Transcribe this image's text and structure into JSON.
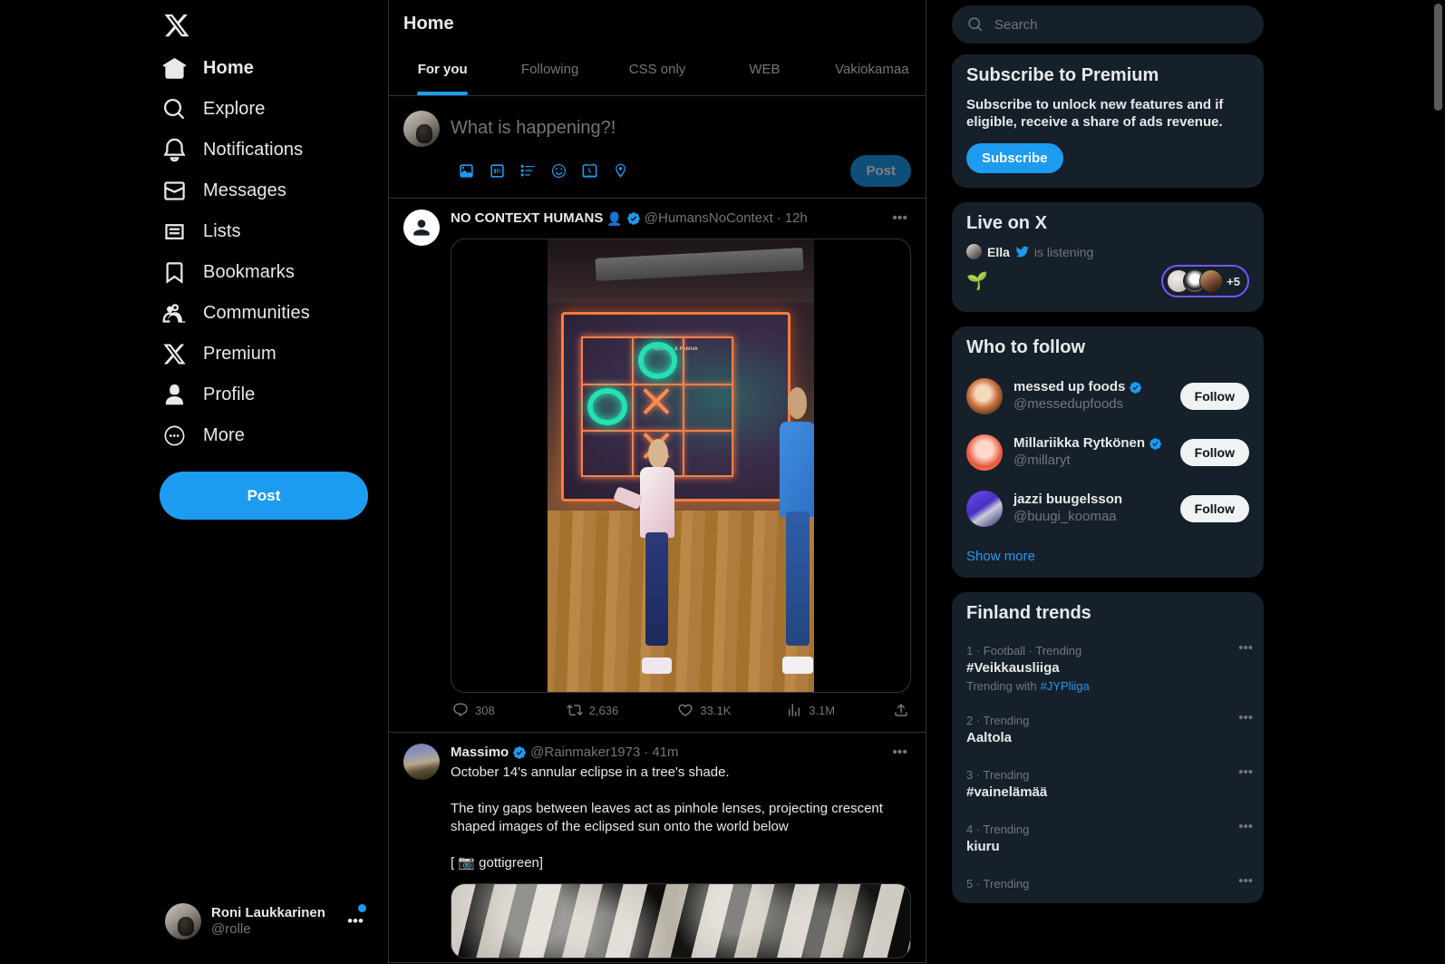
{
  "sidebar": {
    "logo": "x-logo",
    "items": [
      {
        "label": "Home",
        "icon": "home-icon"
      },
      {
        "label": "Explore",
        "icon": "search-icon"
      },
      {
        "label": "Notifications",
        "icon": "bell-icon"
      },
      {
        "label": "Messages",
        "icon": "envelope-icon"
      },
      {
        "label": "Lists",
        "icon": "list-icon"
      },
      {
        "label": "Bookmarks",
        "icon": "bookmark-icon"
      },
      {
        "label": "Communities",
        "icon": "people-icon"
      },
      {
        "label": "Premium",
        "icon": "x-icon"
      },
      {
        "label": "Profile",
        "icon": "person-icon"
      },
      {
        "label": "More",
        "icon": "more-circle-icon"
      }
    ],
    "post_button": "Post",
    "account": {
      "name": "Roni Laukkarinen",
      "handle": "@rolle",
      "menu": "•••"
    }
  },
  "main": {
    "title": "Home",
    "tabs": [
      {
        "label": "For you",
        "active": true
      },
      {
        "label": "Following",
        "active": false
      },
      {
        "label": "CSS only",
        "active": false
      },
      {
        "label": "WEB",
        "active": false
      },
      {
        "label": "Vakiokamaa",
        "active": false
      }
    ],
    "compose": {
      "placeholder": "What is happening?!",
      "post_label": "Post",
      "icons": [
        "image-icon",
        "gif-icon",
        "poll-icon",
        "emoji-icon",
        "schedule-icon",
        "location-icon"
      ]
    },
    "tweets": [
      {
        "name": "NO CONTEXT HUMANS",
        "name_emoji": "👤",
        "verified": true,
        "handle": "@HumansNoContext",
        "separator": "·",
        "time": "12h",
        "menu": "•••",
        "text": [],
        "media": "video",
        "video_overlay_label": "Apunlos & Publish",
        "actions": {
          "replies": "308",
          "reposts": "2,636",
          "likes": "33.1K",
          "views": "3.1M",
          "share": "share-icon"
        }
      },
      {
        "name": "Massimo",
        "verified": true,
        "handle": "@Rainmaker1973",
        "separator": "·",
        "time": "41m",
        "menu": "•••",
        "text": [
          "October 14's annular eclipse in a tree's shade.",
          "The tiny gaps between leaves act as pinhole lenses, projecting crescent shaped images of the eclipsed sun onto the world below",
          "[ 📷 gottigreen]"
        ],
        "media": "photo"
      }
    ]
  },
  "right": {
    "search": {
      "placeholder": "Search",
      "icon": "search-icon"
    },
    "premium": {
      "title": "Subscribe to Premium",
      "description": "Subscribe to unlock new features and if eligible, receive a share of ads revenue.",
      "button": "Subscribe"
    },
    "live": {
      "title": "Live on X",
      "host": "Ella",
      "status": "is listening",
      "emoji": "🌱",
      "extra_count": "+5"
    },
    "who_to_follow": {
      "title": "Who to follow",
      "people": [
        {
          "name": "messed up foods",
          "handle": "@messedupfoods",
          "verified": true,
          "follow": "Follow"
        },
        {
          "name": "Millariikka Rytkönen",
          "handle": "@millaryt",
          "verified": true,
          "follow": "Follow"
        },
        {
          "name": "jazzi buugelsson",
          "handle": "@buugi_koomaa",
          "verified": false,
          "follow": "Follow"
        }
      ],
      "show_more": "Show more"
    },
    "trends": {
      "title": "Finland trends",
      "items": [
        {
          "meta": "1 · Football · Trending",
          "name": "#Veikkausliiga",
          "with_label": "Trending with",
          "with_tag": "#JYPliiga",
          "menu": "•••"
        },
        {
          "meta": "2 · Trending",
          "name": "Aaltola",
          "menu": "•••"
        },
        {
          "meta": "3 · Trending",
          "name": "#vainelämää",
          "menu": "•••"
        },
        {
          "meta": "4 · Trending",
          "name": "kiuru",
          "menu": "•••"
        },
        {
          "meta": "5 · Trending",
          "name": "",
          "menu": "•••"
        }
      ]
    }
  },
  "colors": {
    "accent": "#1d9bf0",
    "background": "#000000",
    "panel": "#16202a",
    "muted": "#71767b",
    "border": "#2f3336",
    "live_ring": "#7856ff"
  }
}
